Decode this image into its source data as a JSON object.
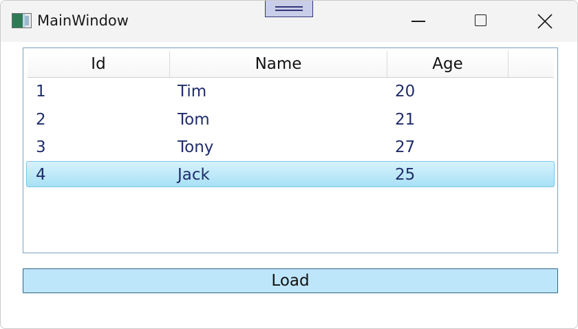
{
  "window": {
    "title": "MainWindow",
    "icon": "app-window-icon"
  },
  "grid": {
    "columns": [
      "Id",
      "Name",
      "Age"
    ],
    "rows": [
      {
        "id": "1",
        "name": "Tim",
        "age": "20"
      },
      {
        "id": "2",
        "name": "Tom",
        "age": "21"
      },
      {
        "id": "3",
        "name": "Tony",
        "age": "27"
      },
      {
        "id": "4",
        "name": "Jack",
        "age": "25"
      }
    ],
    "selected_row": 4
  },
  "actions": {
    "load_label": "Load"
  },
  "colors": {
    "accent_selection": "#a8e0f6",
    "button_background": "#bee6fa",
    "text_cell": "#1f2d6b"
  }
}
